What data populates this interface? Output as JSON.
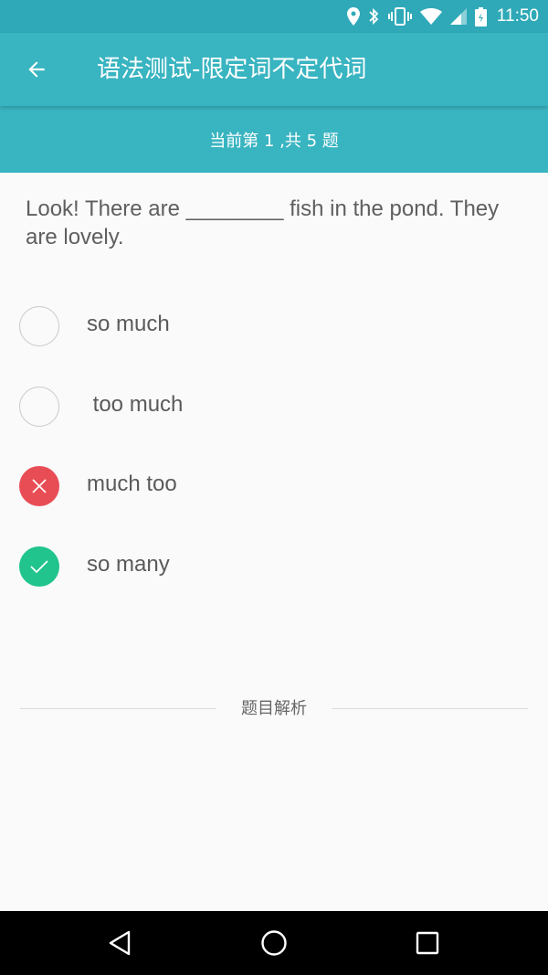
{
  "status_bar": {
    "time": "11:50",
    "icons": [
      "location-icon",
      "bluetooth-icon",
      "vibrate-icon",
      "wifi-icon",
      "signal-icon",
      "battery-icon"
    ]
  },
  "app_bar": {
    "back_icon": "arrow-back-icon",
    "title": "语法测试-限定词不定代词"
  },
  "progress": {
    "text": "当前第 1 ,共 5 题"
  },
  "question": {
    "text": "Look! There are ________ fish in the pond. They are lovely."
  },
  "options": [
    {
      "label": "so much",
      "state": "unselected"
    },
    {
      "label": " too much",
      "state": "unselected"
    },
    {
      "label": "much too",
      "state": "wrong"
    },
    {
      "label": "so many",
      "state": "correct"
    }
  ],
  "analysis": {
    "label": "题目解析"
  },
  "nav_bar": {
    "back": "nav-back-icon",
    "home": "nav-home-icon",
    "recents": "nav-recents-icon"
  },
  "colors": {
    "primary": "#39b4c1",
    "status_bar": "#2fa9b8",
    "wrong": "#e84d55",
    "correct": "#20c48c"
  }
}
